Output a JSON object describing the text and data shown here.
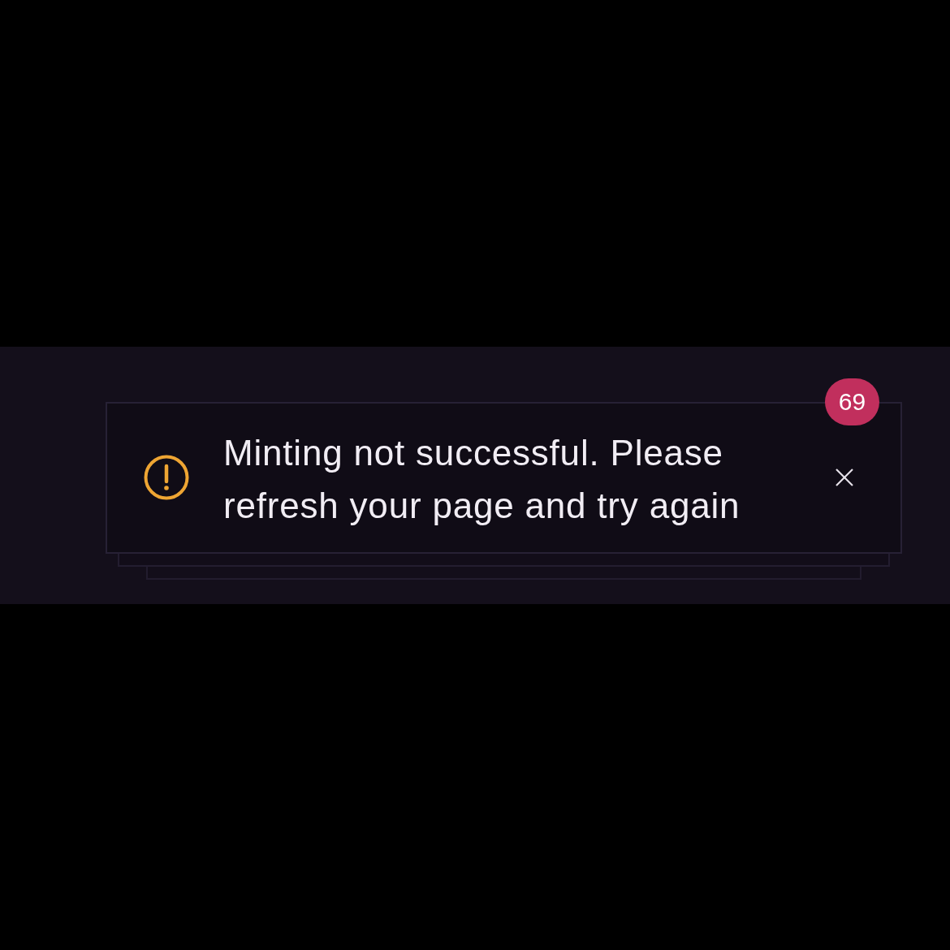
{
  "toast": {
    "message": "Minting not successful. Please refresh your page and try again",
    "badge": "69"
  }
}
